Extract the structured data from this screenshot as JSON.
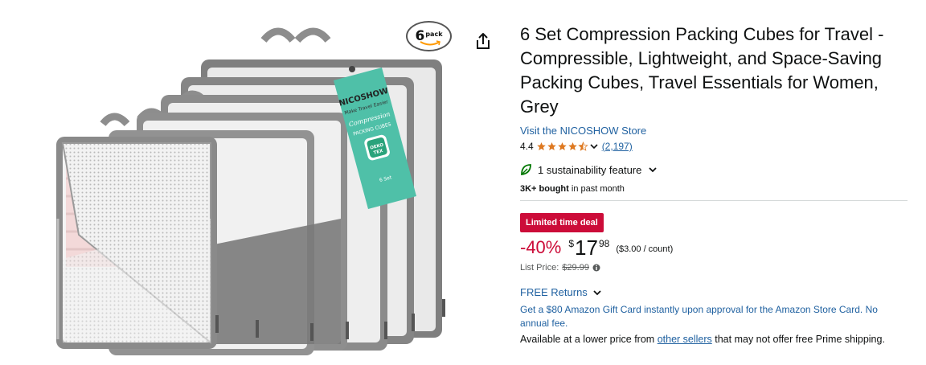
{
  "product": {
    "title": "6 Set Compression Packing Cubes for Travel - Compressible, Lightweight, and Space-Saving Packing Cubes, Travel Essentials for Women, Grey",
    "store_link": "Visit the NICOSHOW Store",
    "rating": "4.4",
    "rating_count": "(2,197)",
    "sustainability": "1 sustainability feature",
    "bought_bold": "3K+ bought",
    "bought_rest": " in past month",
    "deal_badge": "Limited time deal",
    "discount": "-40%",
    "price_symbol": "$",
    "price_whole": "17",
    "price_fraction": "98",
    "unit_price": "($3.00 / count)",
    "list_price_label": "List Price:",
    "list_price": "$29.99",
    "free_returns": "FREE Returns",
    "gift_card": "Get a $80 Amazon Gift Card instantly upon approval for the Amazon Store Card. No annual fee.",
    "avail_prefix": "Available at a lower price from ",
    "avail_link": "other sellers",
    "avail_suffix": " that may not offer free Prime shipping."
  },
  "image": {
    "pack_number": "6",
    "pack_word": "pack",
    "brand": "NICOSHOW",
    "tagline": "Make Travel Easier",
    "script_text": "Compression",
    "tag_label": "PACKING CUBES",
    "oeko_line1": "OEKO",
    "oeko_line2": "TEX",
    "set_label": "6 Set"
  },
  "icons": {
    "share": "share-icon",
    "star": "star-icon",
    "leaf": "leaf-icon",
    "chevron": "chevron-down-icon",
    "info": "info-icon"
  },
  "colors": {
    "link": "#2162a1",
    "deal": "#cc0c39",
    "star": "#de7921",
    "tag": "#4fc0a8"
  },
  "rating_value": 4.4
}
